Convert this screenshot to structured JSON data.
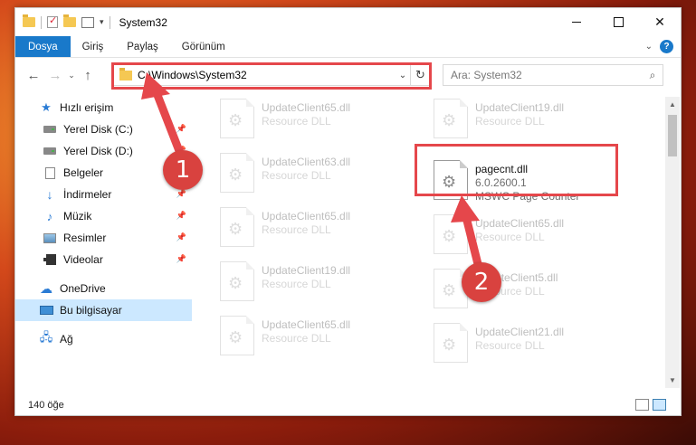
{
  "window": {
    "title": "System32",
    "controls": {
      "minimize": "",
      "maximize": "",
      "close": "✕"
    }
  },
  "ribbon": {
    "tabs": [
      "Dosya",
      "Giriş",
      "Paylaş",
      "Görünüm"
    ],
    "help": "?"
  },
  "navigation": {
    "back": "←",
    "forward": "→",
    "recent": "⌄",
    "up": "↑",
    "address": "C:\\Windows\\System32",
    "search_placeholder": "Ara: System32"
  },
  "sidebar": {
    "items": [
      {
        "label": "Hızlı erişim",
        "icon": "star-icon"
      },
      {
        "label": "Yerel Disk (C:)",
        "icon": "drive-icon",
        "pinned": true
      },
      {
        "label": "Yerel Disk (D:)",
        "icon": "drive-icon",
        "pinned": true
      },
      {
        "label": "Belgeler",
        "icon": "document-icon",
        "pinned": true
      },
      {
        "label": "İndirmeler",
        "icon": "download-icon",
        "pinned": true
      },
      {
        "label": "Müzik",
        "icon": "music-icon",
        "pinned": true
      },
      {
        "label": "Resimler",
        "icon": "pictures-icon",
        "pinned": true
      },
      {
        "label": "Videolar",
        "icon": "video-icon",
        "pinned": true
      },
      {
        "label": "OneDrive",
        "icon": "cloud-icon"
      },
      {
        "label": "Bu bilgisayar",
        "icon": "computer-icon",
        "selected": true
      },
      {
        "label": "Ağ",
        "icon": "network-icon"
      }
    ]
  },
  "files": {
    "left_column": [
      {
        "name": "UpdateClient65.dll",
        "type": "Resource DLL"
      },
      {
        "name": "UpdateClient63.dll",
        "type": "Resource DLL"
      },
      {
        "name": "UpdateClient65.dll",
        "type": "Resource DLL"
      },
      {
        "name": "UpdateClient19.dll",
        "type": "Resource DLL"
      },
      {
        "name": "UpdateClient65.dll",
        "type": "Resource DLL"
      }
    ],
    "right_column": [
      {
        "name": "UpdateClient19.dll",
        "type": "Resource DLL"
      },
      {
        "name": "pagecnt.dll",
        "version": "6.0.2600.1",
        "description": "MSWC Page Counter"
      },
      {
        "name": "UpdateClient65.dll",
        "type": "Resource DLL"
      },
      {
        "name": "UpdateClient5.dll",
        "type": "Resource DLL"
      },
      {
        "name": "UpdateClient21.dll",
        "type": "Resource DLL"
      }
    ]
  },
  "status": {
    "item_count": "140 öğe"
  },
  "annotations": {
    "step1": "1",
    "step2": "2",
    "accent": "#e5474b"
  }
}
